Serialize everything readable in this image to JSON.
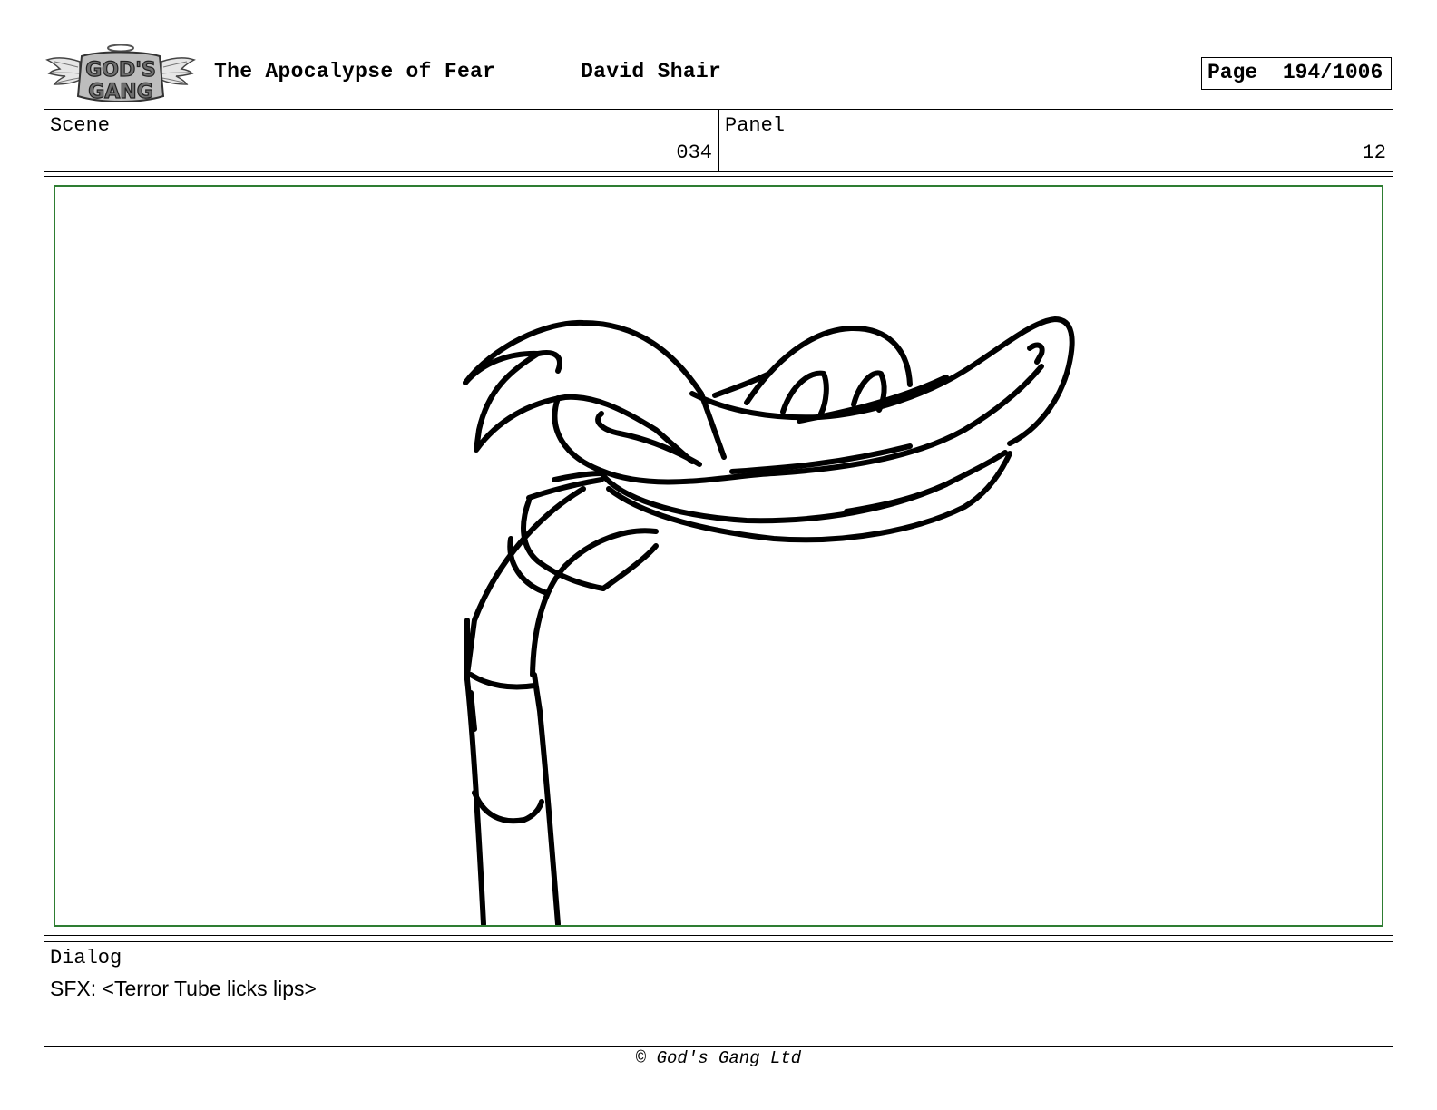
{
  "header": {
    "logo": {
      "icon": "gods-gang-winged-logo-icon",
      "text_line1": "GOD'S",
      "text_line2": "GANG"
    },
    "title": "The Apocalypse of Fear",
    "author": "David Shair",
    "page_label": "Page",
    "page_number": "194/1006"
  },
  "info": {
    "scene_label": "Scene",
    "scene_value": "034",
    "panel_label": "Panel",
    "panel_value": "12"
  },
  "panel_frame": {
    "border_color": "#2e7d32",
    "drawing": "terror-tube-sketch"
  },
  "dialog": {
    "label": "Dialog",
    "text": "SFX: <Terror Tube licks lips>"
  },
  "footer": {
    "copyright": "© God's Gang Ltd"
  }
}
